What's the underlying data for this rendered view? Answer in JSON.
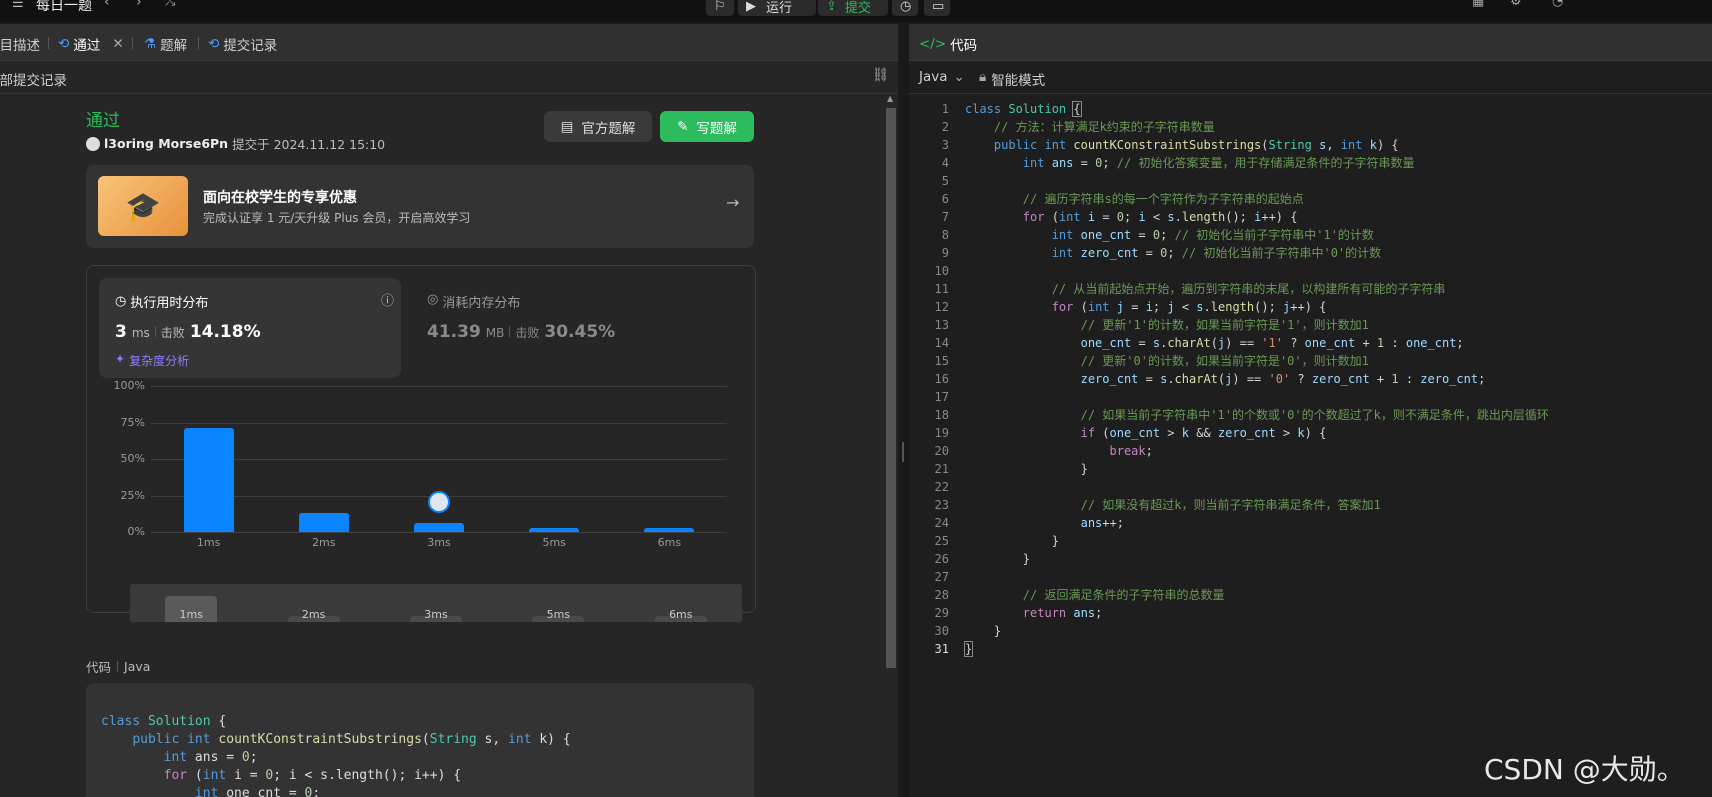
{
  "topbar": {
    "title": "每日一题",
    "run_label": "运行",
    "submit_label": "提交"
  },
  "left": {
    "tabs": [
      {
        "label": "题目描述"
      },
      {
        "label": "通过"
      },
      {
        "label": "题解"
      },
      {
        "label": "提交记录"
      }
    ],
    "subbar_label": "全部提交记录",
    "status": "通过",
    "user": "l3oring Morse6Pn",
    "submitted_at": "提交于 2024.11.12 15:10",
    "official_solution_label": "官方题解",
    "write_solution_label": "写题解",
    "promo": {
      "title": "面向在校学生的专享优惠",
      "subtitle": "完成认证享 1 元/天升级 Plus 会员，开启高效学习"
    },
    "runtime": {
      "title": "执行用时分布",
      "value": "3",
      "unit": "ms",
      "beat_label": "击败",
      "beat_pct": "14.18%",
      "complexity_label": "复杂度分析"
    },
    "memory": {
      "title": "消耗内存分布",
      "value": "41.39",
      "unit": "MB",
      "beat_label": "击败",
      "beat_pct": "30.45%"
    },
    "code_header": {
      "label": "代码",
      "lang": "Java"
    }
  },
  "chart_data": {
    "type": "bar",
    "categories": [
      "1ms",
      "2ms",
      "3ms",
      "5ms",
      "6ms"
    ],
    "values": [
      71,
      13,
      6,
      3,
      3
    ],
    "ylim": [
      0,
      100
    ],
    "yticks": [
      "100%",
      "75%",
      "50%",
      "25%",
      "0%"
    ],
    "grid": true,
    "highlight": "3ms"
  },
  "right": {
    "tab_label": "代码",
    "lang": "Java",
    "mode": "智能模式"
  },
  "watermark": "CSDN @大勋。",
  "colors": {
    "accent_green": "#2cbb5d",
    "bar_blue": "#0a84ff",
    "status_green": "#2cbb5d"
  }
}
